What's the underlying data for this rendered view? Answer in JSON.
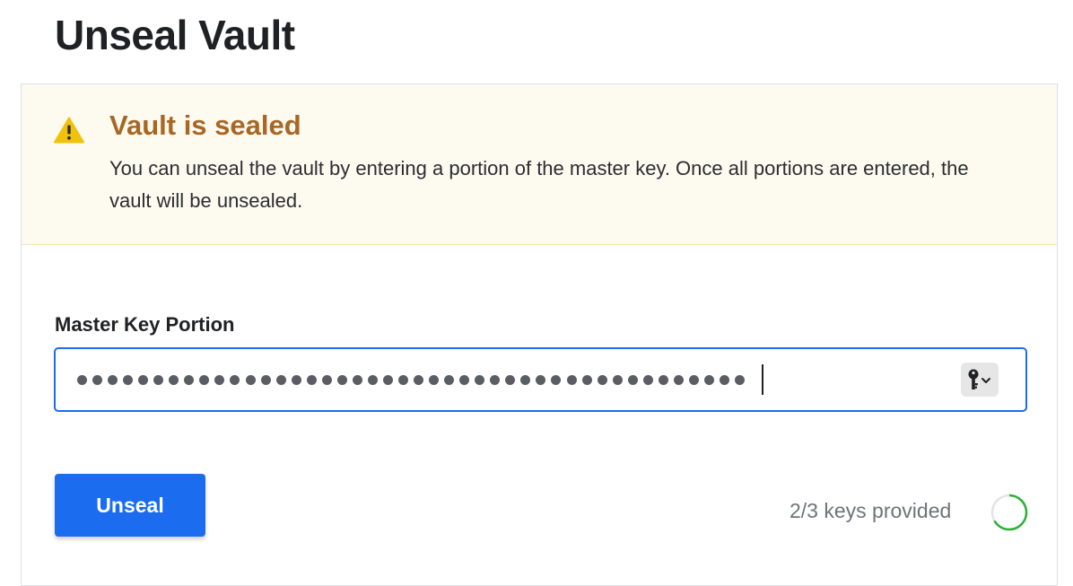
{
  "page": {
    "title": "Unseal Vault"
  },
  "alert": {
    "icon": "warning-triangle-icon",
    "title": "Vault is sealed",
    "body": "You can unseal the vault by entering a portion of the master key. Once all portions are entered, the vault will be unsealed.",
    "colors": {
      "background": "#fdfaf0",
      "title": "#a86724",
      "icon": "#f0c20b"
    }
  },
  "form": {
    "field_label": "Master Key Portion",
    "masked_value": "••••••••••••••••••••••••••••••••••••••••••••",
    "masked_length": 44,
    "keychain_icon": "key-icon",
    "submit_label": "Unseal"
  },
  "progress": {
    "text": "2/3 keys provided",
    "provided": 2,
    "required": 3,
    "ring_color": "#2eb039"
  },
  "colors": {
    "accent": "#1c6cf0"
  }
}
